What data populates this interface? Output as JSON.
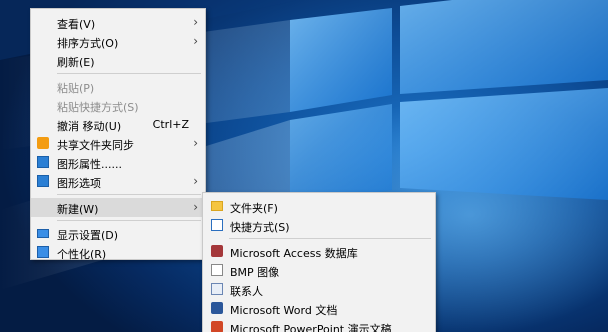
{
  "context_menu": {
    "items": [
      {
        "label": "查看(V)",
        "has_submenu": true
      },
      {
        "label": "排序方式(O)",
        "has_submenu": true
      },
      {
        "label": "刷新(E)"
      },
      {
        "label": "粘贴(P)",
        "disabled": true
      },
      {
        "label": "粘贴快捷方式(S)",
        "disabled": true
      },
      {
        "label": "撤消 移动(U)",
        "shortcut": "Ctrl+Z"
      },
      {
        "label": "共享文件夹同步",
        "has_submenu": true,
        "icon": "sync-folder-icon"
      },
      {
        "label": "图形属性......",
        "icon": "graphics-properties-icon"
      },
      {
        "label": "图形选项",
        "has_submenu": true,
        "icon": "graphics-options-icon"
      },
      {
        "label": "新建(W)",
        "has_submenu": true,
        "highlighted": true
      },
      {
        "label": "显示设置(D)",
        "icon": "display-settings-icon"
      },
      {
        "label": "个性化(R)",
        "icon": "personalize-icon"
      }
    ]
  },
  "new_submenu": {
    "items": [
      {
        "label": "文件夹(F)",
        "icon": "folder-icon"
      },
      {
        "label": "快捷方式(S)",
        "icon": "shortcut-icon"
      },
      {
        "label": "Microsoft Access 数据库",
        "icon": "access-icon"
      },
      {
        "label": "BMP 图像",
        "icon": "bmp-image-icon"
      },
      {
        "label": "联系人",
        "icon": "contact-icon"
      },
      {
        "label": "Microsoft Word 文档",
        "icon": "word-icon"
      },
      {
        "label": "Microsoft PowerPoint 演示文稿",
        "icon": "powerpoint-icon"
      }
    ]
  },
  "colors": {
    "menu_background": "#f2f2f2",
    "highlight": "#dadada",
    "desktop_blue": "#0d4c96"
  }
}
